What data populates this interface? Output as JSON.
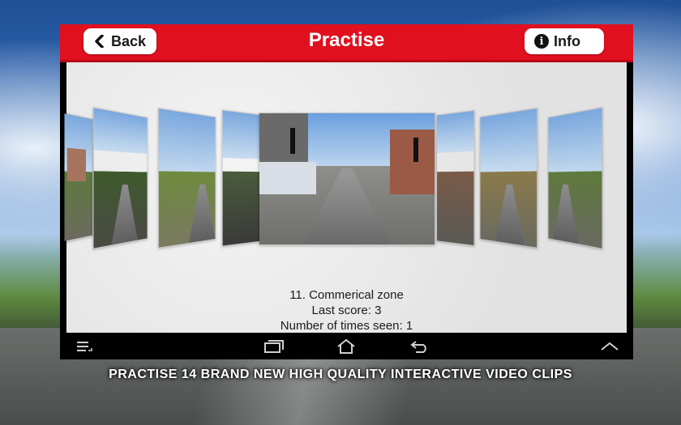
{
  "header": {
    "title": "Practise",
    "back_label": "Back",
    "info_label": "Info"
  },
  "clip": {
    "title": "11. Commerical zone",
    "last_score": "Last score: 3",
    "times_seen": "Number of times seen: 1"
  },
  "banner": "PRACTISE 14 BRAND NEW HIGH QUALITY INTERACTIVE VIDEO CLIPS",
  "icons": {
    "back": "chevron-left-icon",
    "info": "info-icon",
    "menu": "menu-icon",
    "recents": "recent-apps-icon",
    "home": "home-icon",
    "nav_back": "back-arrow-icon",
    "up": "chevron-up-icon"
  },
  "colors": {
    "header_red": "#e0101f",
    "content_bg": "#e8e8e8"
  }
}
